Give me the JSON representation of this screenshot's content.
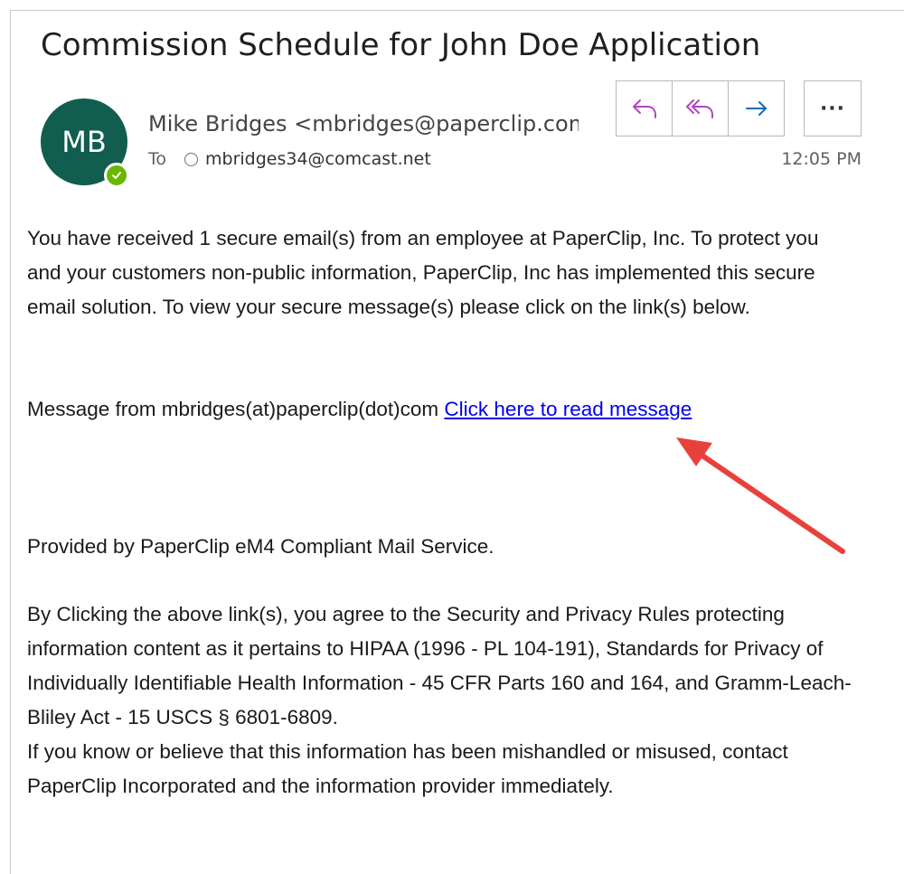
{
  "email": {
    "subject": "Commission Schedule for John Doe Application",
    "avatar_initials": "MB",
    "sender": "Mike Bridges <mbridges@paperclip.com>",
    "to_label": "To",
    "recipient": "mbridges34@comcast.net",
    "time": "12:05 PM"
  },
  "toolbar": {
    "reply_icon": "reply-icon",
    "reply_all_icon": "reply-all-icon",
    "forward_icon": "forward-icon",
    "more_label": "···"
  },
  "body": {
    "para1": "You have received 1 secure email(s) from an employee at PaperClip, Inc. To protect you and your customers non-public information, PaperClip, Inc has implemented this secure email solution. To view your secure message(s) please click on the link(s) below.",
    "para2_prefix": "Message from mbridges(at)paperclip(dot)com ",
    "link_text": "Click here to read message",
    "para3": "Provided by PaperClip eM4 Compliant Mail Service.",
    "para4_line1": "By Clicking the above link(s), you agree to the Security and Privacy Rules protecting information content as it pertains to HIPAA (1996 - PL 104-191), Standards for Privacy of Individually Identifiable Health Information - 45 CFR Parts 160 and 164, and Gramm-Leach-Bliley Act - 15 USCS § 6801-6809.",
    "para4_line2": "If you know or believe that this information has been mishandled or misused, contact PaperClip Incorporated and the information provider immediately."
  },
  "colors": {
    "avatar_bg": "#115d4f",
    "presence": "#6bb700",
    "reply_purple": "#b146c2",
    "forward_blue": "#0f6cbd",
    "link": "#0000ee",
    "arrow": "#e8413c"
  }
}
